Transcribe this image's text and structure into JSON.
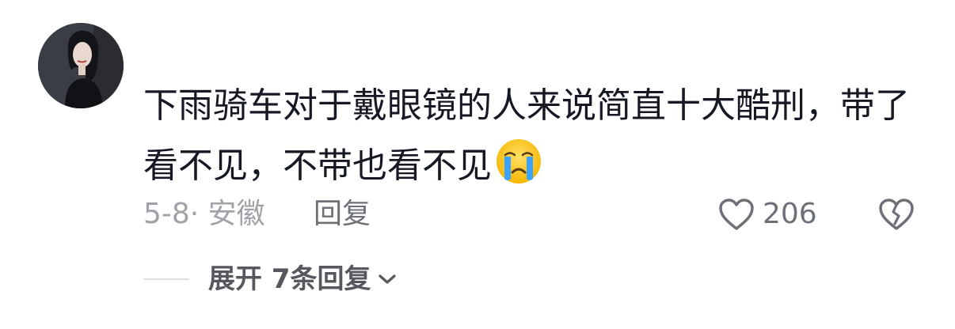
{
  "comment": {
    "text_line1": "下雨骑车对于戴眼镜的人来说简直十大酷刑，带了",
    "text_line2": "看不见，不带也看不见"
  },
  "meta": {
    "date_location": "5-8· 安徽",
    "reply_label": "回复",
    "like_count": "206"
  },
  "expand": {
    "label": "展开 7条回复"
  },
  "icons": {
    "emoji": "crying-face-icon",
    "like": "heart-outline-icon",
    "dislike": "broken-heart-icon",
    "expand": "chevron-down-icon"
  },
  "colors": {
    "text": "#161823",
    "secondary": "#a0a2a8",
    "action": "#6e7077"
  }
}
